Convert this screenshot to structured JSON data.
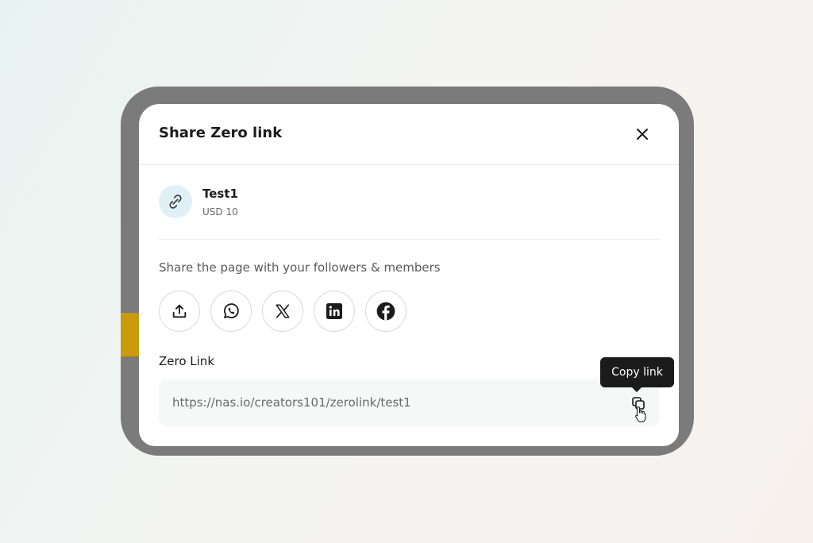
{
  "modal": {
    "title": "Share Zero link"
  },
  "product": {
    "name": "Test1",
    "price": "USD 10",
    "icon": "link-icon"
  },
  "share": {
    "prompt": "Share the page with your followers & members",
    "buttons": [
      {
        "icon": "share-upload-icon"
      },
      {
        "icon": "whatsapp-icon"
      },
      {
        "icon": "x-icon"
      },
      {
        "icon": "linkedin-icon"
      },
      {
        "icon": "facebook-icon"
      }
    ]
  },
  "zero_link": {
    "label": "Zero Link",
    "url": "https://nas.io/creators101/zerolink/test1",
    "copy_tooltip": "Copy link"
  },
  "colors": {
    "tooltip_bg": "#1b1b1b",
    "product_icon_bg": "#dff1f7",
    "overlay_gray": "#7b7b7b"
  }
}
